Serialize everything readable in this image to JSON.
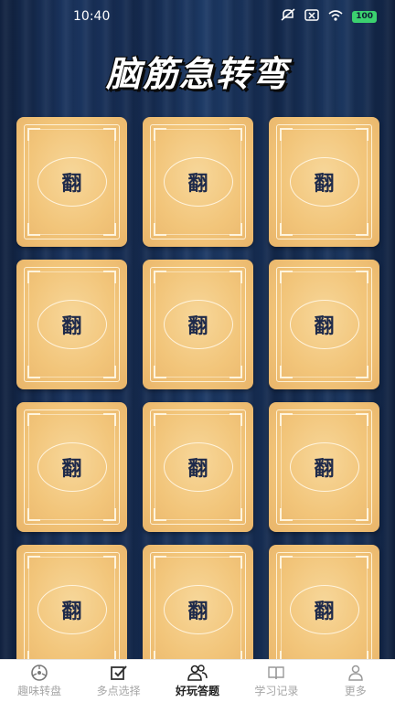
{
  "status_bar": {
    "time": "10:40",
    "battery": "100"
  },
  "header": {
    "title": "脑筋急转弯"
  },
  "cards": [
    {
      "label": "翻"
    },
    {
      "label": "翻"
    },
    {
      "label": "翻"
    },
    {
      "label": "翻"
    },
    {
      "label": "翻"
    },
    {
      "label": "翻"
    },
    {
      "label": "翻"
    },
    {
      "label": "翻"
    },
    {
      "label": "翻"
    },
    {
      "label": "翻"
    },
    {
      "label": "翻"
    },
    {
      "label": "翻"
    }
  ],
  "nav": [
    {
      "label": "趣味转盘",
      "icon": "wheel-icon",
      "active": false
    },
    {
      "label": "多点选择",
      "icon": "checkbox-icon",
      "active": false
    },
    {
      "label": "好玩答题",
      "icon": "users-icon",
      "active": true
    },
    {
      "label": "学习记录",
      "icon": "book-icon",
      "active": false
    },
    {
      "label": "更多",
      "icon": "person-icon",
      "active": false
    }
  ],
  "colors": {
    "accent_active": "#222222",
    "inactive": "#a6a6a6",
    "card": "#f2c57a",
    "battery": "#3bd16f"
  }
}
